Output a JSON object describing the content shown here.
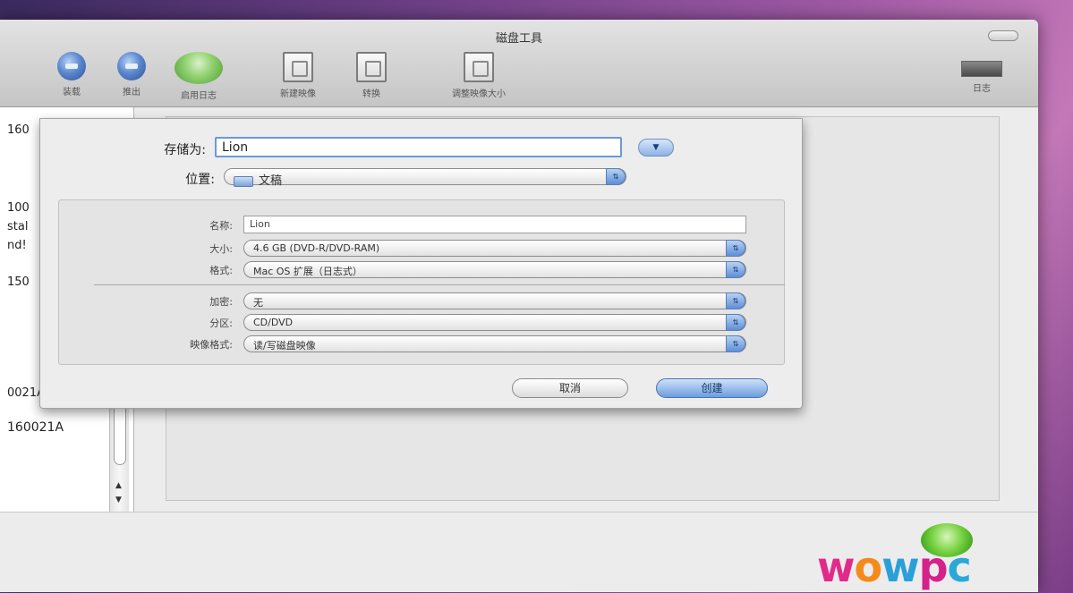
{
  "window": {
    "title": "磁盘工具"
  },
  "toolbar": {
    "items": [
      {
        "label": "装载",
        "icon": "mount-ball-icon"
      },
      {
        "label": "推出",
        "icon": "eject-ball-icon"
      },
      {
        "label": "启用日志",
        "icon": "journal-ball-icon"
      },
      {
        "label": "新建映像",
        "icon": "new-image-icon"
      },
      {
        "label": "转换",
        "icon": "convert-icon"
      },
      {
        "label": "调整映像大小",
        "icon": "resize-image-icon"
      }
    ],
    "log_label": "日志"
  },
  "sidebar": {
    "items": [
      {
        "text": "160"
      },
      {
        "text": "100"
      },
      {
        "text": "stal"
      },
      {
        "text": "nd!"
      },
      {
        "text": "150"
      },
      {
        "text": "0021A"
      },
      {
        "text": "160021A"
      }
    ]
  },
  "sheet": {
    "save_as_label": "存储为:",
    "save_as_value": "Lion",
    "location_label": "位置:",
    "location_value": "文稿",
    "fields": {
      "name_label": "名称:",
      "name_value": "Lion",
      "size_label": "大小:",
      "size_value": "4.6 GB (DVD-R/DVD-RAM)",
      "format_label": "格式:",
      "format_value": "Mac OS 扩展（日志式）",
      "encryption_label": "加密:",
      "encryption_value": "无",
      "partitions_label": "分区:",
      "partitions_value": "CD/DVD",
      "image_format_label": "映像格式:",
      "image_format_value": "读/写磁盘映像"
    },
    "cancel_label": "取消",
    "create_label": "创建"
  },
  "watermark": {
    "text": "wowpc"
  },
  "colors": {
    "accent": "#6b9ad6",
    "desktop": "#a05aa5"
  }
}
